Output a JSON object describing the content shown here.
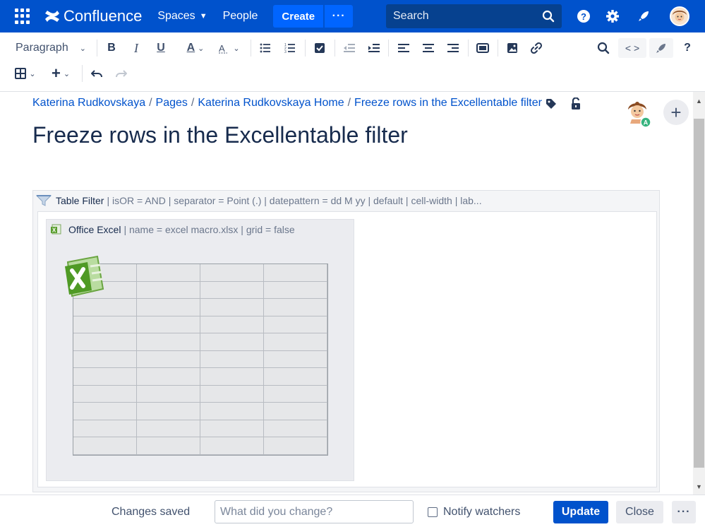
{
  "topnav": {
    "logo_text": "Confluence",
    "spaces_label": "Spaces",
    "people_label": "People",
    "create_label": "Create",
    "more_label": "···",
    "search_placeholder": "Search",
    "icons": [
      "app-switcher-icon",
      "help-icon",
      "settings-icon",
      "notifications-rocket-icon",
      "user-avatar"
    ]
  },
  "toolbar": {
    "paragraph_label": "Paragraph",
    "bold": "B",
    "italic": "I",
    "underline": "U",
    "text_color": "A",
    "code_label": "< >",
    "help": "?"
  },
  "breadcrumb": {
    "items": [
      "Katerina Rudkovskaya",
      "Pages",
      "Katerina Rudkovskaya Home",
      "Freeze rows in the Excellentable filter"
    ]
  },
  "page": {
    "title": "Freeze rows in the Excellentable filter"
  },
  "table_filter": {
    "name": "Table Filter",
    "params": "| isOR = AND | separator = Point (.) | datepattern = dd M yy | default | cell-width | lab..."
  },
  "office_excel": {
    "name": "Office Excel",
    "params": "| name = excel macro.xlsx | grid = false"
  },
  "footer": {
    "status": "Changes saved",
    "comment_placeholder": "What did you change?",
    "notify_label": "Notify watchers",
    "update_label": "Update",
    "close_label": "Close",
    "more_label": "···"
  },
  "colors": {
    "nav_bg": "#0052cc",
    "primary_button": "#0052cc",
    "link": "#0052cc"
  }
}
